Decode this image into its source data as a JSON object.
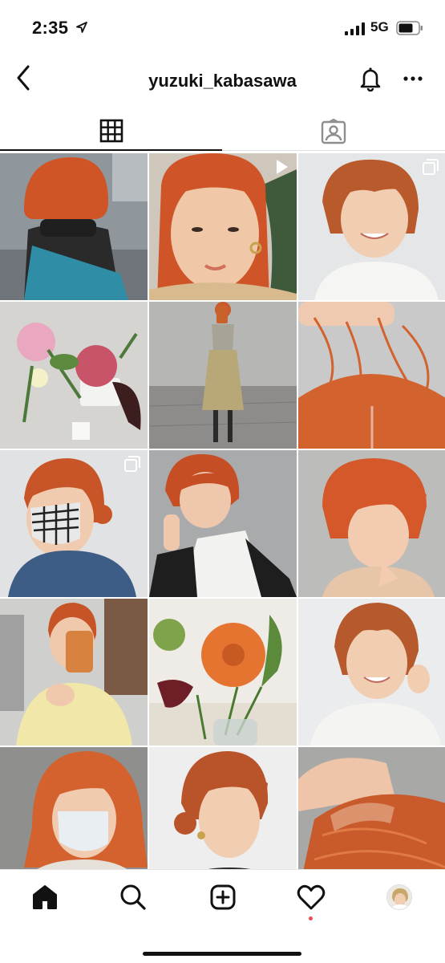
{
  "status_bar": {
    "time": "2:35",
    "network": "5G"
  },
  "header": {
    "username": "yuzuki_kabasawa"
  },
  "tabs": [
    {
      "name": "grid",
      "icon": "grid-icon",
      "active": true
    },
    {
      "name": "tagged",
      "icon": "tagged-person-icon",
      "active": false
    }
  ],
  "posts": [
    {
      "subject": "orange bob, back view",
      "badge": null
    },
    {
      "subject": "orange bangs portrait",
      "badge": "video-icon"
    },
    {
      "subject": "curly orange bob smiling",
      "badge": "carousel-icon"
    },
    {
      "subject": "flower arrangement",
      "badge": null
    },
    {
      "subject": "full outfit mirror selfie",
      "badge": null
    },
    {
      "subject": "orange hair close-up",
      "badge": null
    },
    {
      "subject": "orange bun with mask",
      "badge": "carousel-icon"
    },
    {
      "subject": "orange bob, white vest",
      "badge": null
    },
    {
      "subject": "orange bob side profile",
      "badge": null
    },
    {
      "subject": "mirror selfie, yellow top",
      "badge": null
    },
    {
      "subject": "orange dahlia flowers",
      "badge": null
    },
    {
      "subject": "curly orange hair smiling",
      "badge": null
    },
    {
      "subject": "long orange hair with mask",
      "badge": null
    },
    {
      "subject": "orange bun side profile",
      "badge": null
    },
    {
      "subject": "orange hair roots close-up",
      "badge": null
    }
  ],
  "bottom_nav": [
    {
      "name": "home",
      "icon": "home-icon",
      "active": true
    },
    {
      "name": "search",
      "icon": "search-icon"
    },
    {
      "name": "new-post",
      "icon": "plus-square-icon"
    },
    {
      "name": "activity",
      "icon": "heart-icon",
      "has_notification": true
    },
    {
      "name": "profile",
      "icon": "avatar"
    }
  ],
  "colors": {
    "accent_hair": "#d45a2a",
    "notification_dot": "#ed4956",
    "text": "#111111"
  }
}
